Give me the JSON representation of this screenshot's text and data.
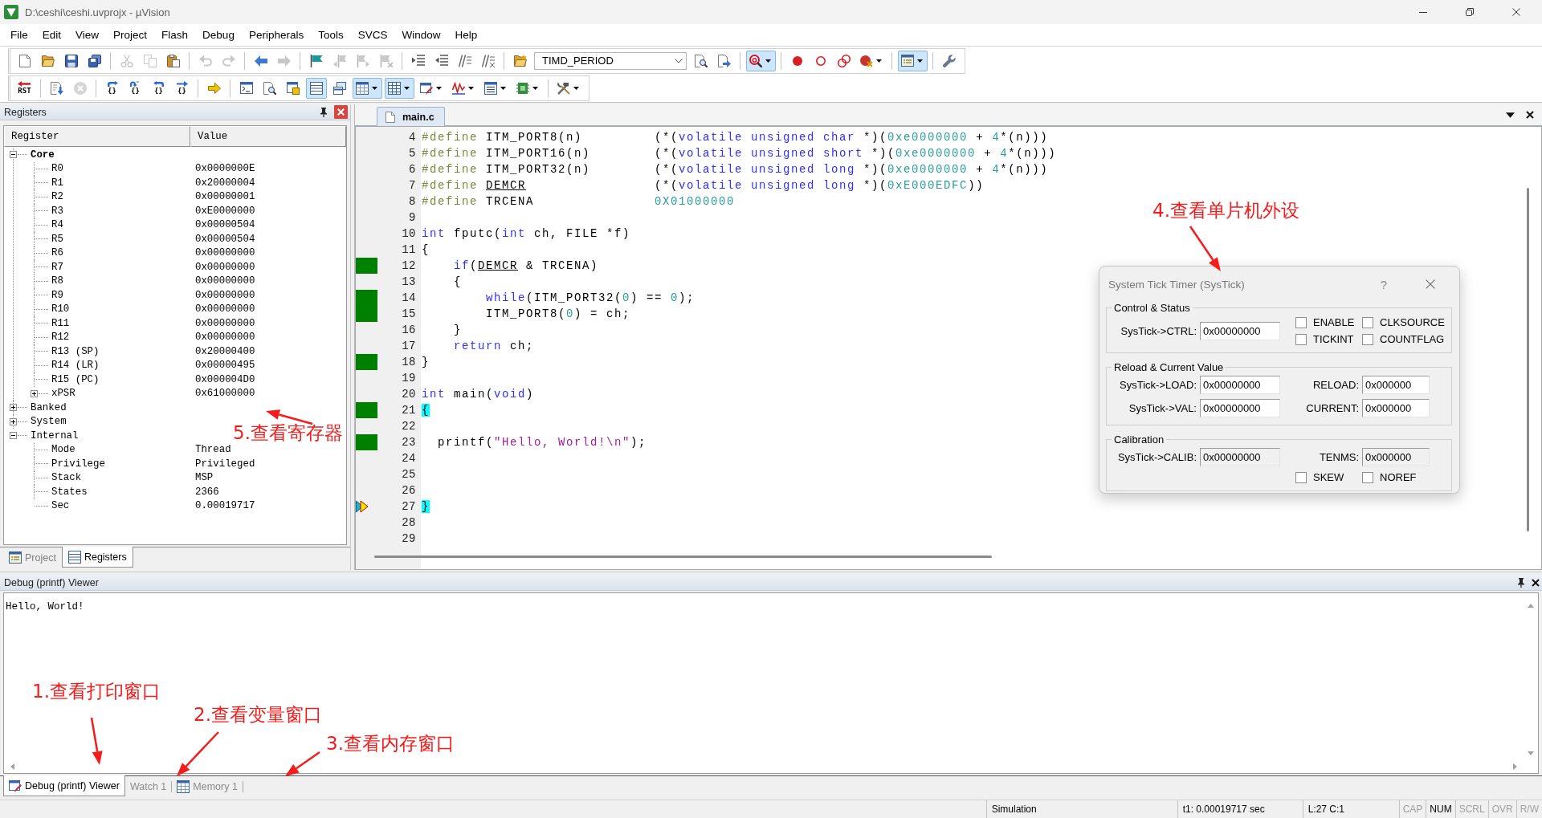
{
  "window": {
    "title": "D:\\ceshi\\ceshi.uvprojx - µVision"
  },
  "menu": [
    "File",
    "Edit",
    "View",
    "Project",
    "Flash",
    "Debug",
    "Peripherals",
    "Tools",
    "SVCS",
    "Window",
    "Help"
  ],
  "toolbars": [
    {
      "items": [
        {
          "kind": "button",
          "pressed": false,
          "disabled": false,
          "menu": false
        },
        {
          "kind": "button",
          "pressed": false,
          "disabled": false,
          "menu": false
        },
        {
          "kind": "button",
          "pressed": false,
          "disabled": false,
          "menu": false
        },
        {
          "kind": "button",
          "pressed": false,
          "disabled": false,
          "menu": false
        },
        {
          "kind": "separator"
        },
        {
          "kind": "button",
          "pressed": false,
          "disabled": true,
          "menu": false
        },
        {
          "kind": "button",
          "pressed": false,
          "disabled": true,
          "menu": false
        },
        {
          "kind": "button",
          "pressed": false,
          "disabled": false,
          "menu": false
        },
        {
          "kind": "separator"
        },
        {
          "kind": "button",
          "pressed": false,
          "disabled": true,
          "menu": false
        },
        {
          "kind": "button",
          "pressed": false,
          "disabled": true,
          "menu": false
        },
        {
          "kind": "separator"
        },
        {
          "kind": "button",
          "pressed": false,
          "disabled": false,
          "menu": false
        },
        {
          "kind": "button",
          "pressed": false,
          "disabled": true,
          "menu": false
        },
        {
          "kind": "separator"
        },
        {
          "kind": "button",
          "pressed": false,
          "disabled": false,
          "menu": false
        },
        {
          "kind": "button",
          "pressed": false,
          "disabled": true,
          "menu": false
        },
        {
          "kind": "button",
          "pressed": false,
          "disabled": true,
          "menu": false
        },
        {
          "kind": "button",
          "pressed": false,
          "disabled": true,
          "menu": false
        },
        {
          "kind": "separator"
        },
        {
          "kind": "button",
          "pressed": false,
          "disabled": false,
          "menu": false
        },
        {
          "kind": "button",
          "pressed": false,
          "disabled": false,
          "menu": false
        },
        {
          "kind": "button",
          "pressed": false,
          "disabled": false,
          "menu": false
        },
        {
          "kind": "button",
          "pressed": false,
          "disabled": false,
          "menu": false
        },
        {
          "kind": "separator"
        },
        {
          "kind": "button",
          "pressed": false,
          "disabled": false,
          "menu": false
        },
        {
          "kind": "combo",
          "value": "TIMD_PERIOD"
        },
        {
          "kind": "button",
          "pressed": false,
          "disabled": false,
          "menu": false
        },
        {
          "kind": "button",
          "pressed": false,
          "disabled": false,
          "menu": false
        },
        {
          "kind": "separator"
        },
        {
          "kind": "button",
          "pressed": true,
          "disabled": false,
          "menu": true
        },
        {
          "kind": "separator"
        },
        {
          "kind": "button",
          "pressed": false,
          "disabled": false,
          "menu": false
        },
        {
          "kind": "button",
          "pressed": false,
          "disabled": false,
          "menu": false
        },
        {
          "kind": "button",
          "pressed": false,
          "disabled": false,
          "menu": false
        },
        {
          "kind": "button",
          "pressed": false,
          "disabled": false,
          "menu": true
        },
        {
          "kind": "separator"
        },
        {
          "kind": "button",
          "pressed": true,
          "disabled": false,
          "menu": true
        },
        {
          "kind": "separator"
        },
        {
          "kind": "button",
          "pressed": false,
          "disabled": false,
          "menu": false
        }
      ]
    },
    {
      "items": [
        {
          "kind": "button",
          "label": "RST",
          "pressed": false,
          "disabled": false,
          "menu": false
        },
        {
          "kind": "separator"
        },
        {
          "kind": "button",
          "pressed": false,
          "disabled": false,
          "menu": false
        },
        {
          "kind": "button",
          "pressed": false,
          "disabled": true,
          "menu": false
        },
        {
          "kind": "separator"
        },
        {
          "kind": "button",
          "label": "{}",
          "pressed": false,
          "disabled": false,
          "menu": false
        },
        {
          "kind": "button",
          "label": "{}",
          "pressed": false,
          "disabled": false,
          "menu": false
        },
        {
          "kind": "button",
          "label": "{}",
          "pressed": false,
          "disabled": false,
          "menu": false
        },
        {
          "kind": "button",
          "label": "{}",
          "pressed": false,
          "disabled": false,
          "menu": false
        },
        {
          "kind": "separator"
        },
        {
          "kind": "button",
          "pressed": false,
          "disabled": false,
          "menu": false
        },
        {
          "kind": "separator"
        },
        {
          "kind": "button",
          "pressed": false,
          "disabled": false,
          "menu": false
        },
        {
          "kind": "button",
          "pressed": false,
          "disabled": false,
          "menu": false
        },
        {
          "kind": "button",
          "pressed": false,
          "disabled": false,
          "menu": false
        },
        {
          "kind": "button",
          "pressed": true,
          "disabled": false,
          "menu": false
        },
        {
          "kind": "button",
          "pressed": false,
          "disabled": false,
          "menu": false
        },
        {
          "kind": "button",
          "pressed": true,
          "disabled": false,
          "menu": true
        },
        {
          "kind": "button",
          "pressed": true,
          "disabled": false,
          "menu": true
        },
        {
          "kind": "button",
          "pressed": false,
          "disabled": false,
          "menu": true
        },
        {
          "kind": "button",
          "pressed": false,
          "disabled": false,
          "menu": true
        },
        {
          "kind": "button",
          "pressed": false,
          "disabled": false,
          "menu": true
        },
        {
          "kind": "button",
          "pressed": false,
          "disabled": false,
          "menu": true
        },
        {
          "kind": "separator"
        },
        {
          "kind": "button",
          "pressed": false,
          "disabled": false,
          "menu": true
        }
      ]
    }
  ],
  "registers_panel": {
    "title": "Registers",
    "columns": [
      "Register",
      "Value"
    ],
    "tree": [
      {
        "name": "Core",
        "bold": true,
        "expanded": true,
        "children": [
          {
            "name": "R0",
            "value": "0x0000000E"
          },
          {
            "name": "R1",
            "value": "0x20000004"
          },
          {
            "name": "R2",
            "value": "0x00000001"
          },
          {
            "name": "R3",
            "value": "0xE0000000"
          },
          {
            "name": "R4",
            "value": "0x00000504"
          },
          {
            "name": "R5",
            "value": "0x00000504"
          },
          {
            "name": "R6",
            "value": "0x00000000"
          },
          {
            "name": "R7",
            "value": "0x00000000"
          },
          {
            "name": "R8",
            "value": "0x00000000"
          },
          {
            "name": "R9",
            "value": "0x00000000"
          },
          {
            "name": "R10",
            "value": "0x00000000"
          },
          {
            "name": "R11",
            "value": "0x00000000"
          },
          {
            "name": "R12",
            "value": "0x00000000"
          },
          {
            "name": "R13 (SP)",
            "value": "0x20000400"
          },
          {
            "name": "R14 (LR)",
            "value": "0x00000495"
          },
          {
            "name": "R15 (PC)",
            "value": "0x000004D0"
          },
          {
            "name": "xPSR",
            "value": "0x61000000",
            "expanded": false
          }
        ]
      },
      {
        "name": "Banked",
        "bold": false,
        "expanded": false
      },
      {
        "name": "System",
        "bold": false,
        "expanded": false
      },
      {
        "name": "Internal",
        "bold": false,
        "expanded": true,
        "children": [
          {
            "name": "Mode",
            "value": "Thread"
          },
          {
            "name": "Privilege",
            "value": "Privileged"
          },
          {
            "name": "Stack",
            "value": "MSP"
          },
          {
            "name": "States",
            "value": "2366"
          },
          {
            "name": "Sec",
            "value": "0.00019717"
          }
        ]
      }
    ],
    "tabs": [
      {
        "label": "Project",
        "selected": false
      },
      {
        "label": "Registers",
        "selected": true
      }
    ]
  },
  "editor": {
    "tabs": [
      {
        "label": "main.c",
        "selected": true
      }
    ],
    "lines": [
      {
        "number": "4",
        "executed": false,
        "current": false,
        "tokens": [
          {
            "kind": "directive",
            "text": "#define"
          },
          {
            "kind": "plain",
            "text": " ITM_PORT8(n)         (*("
          },
          {
            "kind": "keyword",
            "text": "volatile unsigned char"
          },
          {
            "kind": "plain",
            "text": " *)("
          },
          {
            "kind": "number",
            "text": "0xe0000000"
          },
          {
            "kind": "plain",
            "text": " + "
          },
          {
            "kind": "number",
            "text": "4"
          },
          {
            "kind": "plain",
            "text": "*(n)))"
          }
        ]
      },
      {
        "number": "5",
        "executed": false,
        "current": false,
        "tokens": [
          {
            "kind": "directive",
            "text": "#define"
          },
          {
            "kind": "plain",
            "text": " ITM_PORT16(n)        (*("
          },
          {
            "kind": "keyword",
            "text": "volatile unsigned short"
          },
          {
            "kind": "plain",
            "text": " *)("
          },
          {
            "kind": "number",
            "text": "0xe0000000"
          },
          {
            "kind": "plain",
            "text": " + "
          },
          {
            "kind": "number",
            "text": "4"
          },
          {
            "kind": "plain",
            "text": "*(n)))"
          }
        ]
      },
      {
        "number": "6",
        "executed": false,
        "current": false,
        "tokens": [
          {
            "kind": "directive",
            "text": "#define"
          },
          {
            "kind": "plain",
            "text": " ITM_PORT32(n)        (*("
          },
          {
            "kind": "keyword",
            "text": "volatile unsigned long"
          },
          {
            "kind": "plain",
            "text": " *)("
          },
          {
            "kind": "number",
            "text": "0xe0000000"
          },
          {
            "kind": "plain",
            "text": " + "
          },
          {
            "kind": "number",
            "text": "4"
          },
          {
            "kind": "plain",
            "text": "*(n)))"
          }
        ]
      },
      {
        "number": "7",
        "executed": false,
        "current": false,
        "tokens": [
          {
            "kind": "directive",
            "text": "#define "
          },
          {
            "kind": "underlined",
            "text": "DEMCR"
          },
          {
            "kind": "plain",
            "text": "                (*("
          },
          {
            "kind": "keyword",
            "text": "volatile unsigned long"
          },
          {
            "kind": "plain",
            "text": " *)("
          },
          {
            "kind": "number",
            "text": "0xE000EDFC"
          },
          {
            "kind": "plain",
            "text": "))"
          }
        ]
      },
      {
        "number": "8",
        "executed": false,
        "current": false,
        "tokens": [
          {
            "kind": "directive",
            "text": "#define"
          },
          {
            "kind": "plain",
            "text": " TRCENA               "
          },
          {
            "kind": "number",
            "text": "0X01000000"
          }
        ]
      },
      {
        "number": "9",
        "executed": false,
        "current": false
      },
      {
        "number": "10",
        "executed": false,
        "current": false,
        "tokens": [
          {
            "kind": "keyword",
            "text": "int"
          },
          {
            "kind": "plain",
            "text": " fputc("
          },
          {
            "kind": "keyword",
            "text": "int"
          },
          {
            "kind": "plain",
            "text": " ch, FILE *f)"
          }
        ]
      },
      {
        "number": "11",
        "executed": false,
        "current": false,
        "tokens": [
          {
            "kind": "plain",
            "text": "{"
          }
        ]
      },
      {
        "number": "12",
        "executed": true,
        "current": false,
        "tokens": [
          {
            "kind": "keyword",
            "text": "    if"
          },
          {
            "kind": "plain",
            "text": "("
          },
          {
            "kind": "underlined",
            "text": "DEMCR"
          },
          {
            "kind": "plain",
            "text": " & TRCENA)"
          }
        ]
      },
      {
        "number": "13",
        "executed": false,
        "current": false,
        "tokens": [
          {
            "kind": "plain",
            "text": "    {"
          }
        ]
      },
      {
        "number": "14",
        "executed": true,
        "current": false,
        "tokens": [
          {
            "kind": "keyword",
            "text": "        while"
          },
          {
            "kind": "plain",
            "text": "(ITM_PORT32("
          },
          {
            "kind": "number",
            "text": "0"
          },
          {
            "kind": "plain",
            "text": ") == "
          },
          {
            "kind": "number",
            "text": "0"
          },
          {
            "kind": "plain",
            "text": ");"
          }
        ]
      },
      {
        "number": "15",
        "executed": true,
        "current": false,
        "tokens": [
          {
            "kind": "plain",
            "text": "        ITM_PORT8("
          },
          {
            "kind": "number",
            "text": "0"
          },
          {
            "kind": "plain",
            "text": ") = ch;"
          }
        ]
      },
      {
        "number": "16",
        "executed": false,
        "current": false,
        "tokens": [
          {
            "kind": "plain",
            "text": "    }"
          }
        ]
      },
      {
        "number": "17",
        "executed": false,
        "current": false,
        "tokens": [
          {
            "kind": "keyword",
            "text": "    return"
          },
          {
            "kind": "plain",
            "text": " ch;"
          }
        ]
      },
      {
        "number": "18",
        "executed": true,
        "current": false,
        "tokens": [
          {
            "kind": "plain",
            "text": "}"
          }
        ]
      },
      {
        "number": "19",
        "executed": false,
        "current": false
      },
      {
        "number": "20",
        "executed": false,
        "current": false,
        "tokens": [
          {
            "kind": "keyword",
            "text": "int"
          },
          {
            "kind": "plain",
            "text": " main("
          },
          {
            "kind": "keyword",
            "text": "void"
          },
          {
            "kind": "plain",
            "text": ")"
          }
        ]
      },
      {
        "number": "21",
        "executed": true,
        "current": false,
        "tokens": [
          {
            "kind": "highlighted",
            "text": "{"
          }
        ]
      },
      {
        "number": "22",
        "executed": false,
        "current": false
      },
      {
        "number": "23",
        "executed": true,
        "current": false,
        "tokens": [
          {
            "kind": "plain",
            "text": "  printf("
          },
          {
            "kind": "string",
            "text": "\"Hello, World!\\n\""
          },
          {
            "kind": "plain",
            "text": ");"
          }
        ]
      },
      {
        "number": "24",
        "executed": false,
        "current": false
      },
      {
        "number": "25",
        "executed": false,
        "current": false
      },
      {
        "number": "26",
        "executed": false,
        "current": false
      },
      {
        "number": "27",
        "executed": false,
        "current": true,
        "tokens": [
          {
            "kind": "highlighted",
            "text": "}"
          }
        ]
      },
      {
        "number": "28",
        "executed": false,
        "current": false
      },
      {
        "number": "29",
        "executed": false,
        "current": false
      }
    ]
  },
  "systick_dialog": {
    "title": "System Tick Timer (SysTick)",
    "help": "?",
    "groups": [
      {
        "title": "Control & Status",
        "fields": [
          {
            "label": "SysTick->CTRL:",
            "value": "0x00000000",
            "disabled": false
          }
        ],
        "checkboxes": [
          {
            "label": "ENABLE",
            "checked": false
          },
          {
            "label": "CLKSOURCE",
            "checked": false
          },
          {
            "label": "TICKINT",
            "checked": false
          },
          {
            "label": "COUNTFLAG",
            "checked": false
          }
        ]
      },
      {
        "title": "Reload & Current Value",
        "fields": [
          {
            "label": "SysTick->LOAD:",
            "value": "0x00000000",
            "disabled": false
          },
          {
            "label": "RELOAD:",
            "value": "0x000000",
            "disabled": false
          },
          {
            "label": "SysTick->VAL:",
            "value": "0x00000000",
            "disabled": false
          },
          {
            "label": "CURRENT:",
            "value": "0x000000",
            "disabled": false
          }
        ]
      },
      {
        "title": "Calibration",
        "fields": [
          {
            "label": "SysTick->CALIB:",
            "value": "0x00000000",
            "disabled": true
          },
          {
            "label": "TENMS:",
            "value": "0x000000",
            "disabled": true
          }
        ],
        "checkboxes": [
          {
            "label": "SKEW",
            "checked": false
          },
          {
            "label": "NOREF",
            "checked": false
          }
        ]
      }
    ]
  },
  "debug_viewer": {
    "title": "Debug (printf) Viewer",
    "output": "Hello, World!",
    "tabs": [
      {
        "label": "Debug (printf) Viewer",
        "selected": true
      },
      {
        "label": "Watch 1",
        "selected": false
      },
      {
        "label": "Memory 1",
        "selected": false
      }
    ]
  },
  "status_bar": {
    "mode": "Simulation",
    "time": "t1: 0.00019717 sec",
    "cursor": "L:27 C:1",
    "indicators": [
      {
        "label": "CAP",
        "on": false
      },
      {
        "label": "NUM",
        "on": true
      },
      {
        "label": "SCRL",
        "on": false
      },
      {
        "label": "OVR",
        "on": false
      },
      {
        "label": "R/W",
        "on": false
      }
    ]
  },
  "annotations": [
    {
      "text": "4.查看单片机外设"
    },
    {
      "text": "5.查看寄存器"
    },
    {
      "text": "1.查看打印窗口"
    },
    {
      "text": "2.查看变量窗口"
    },
    {
      "text": "3.查看内存窗口"
    }
  ]
}
